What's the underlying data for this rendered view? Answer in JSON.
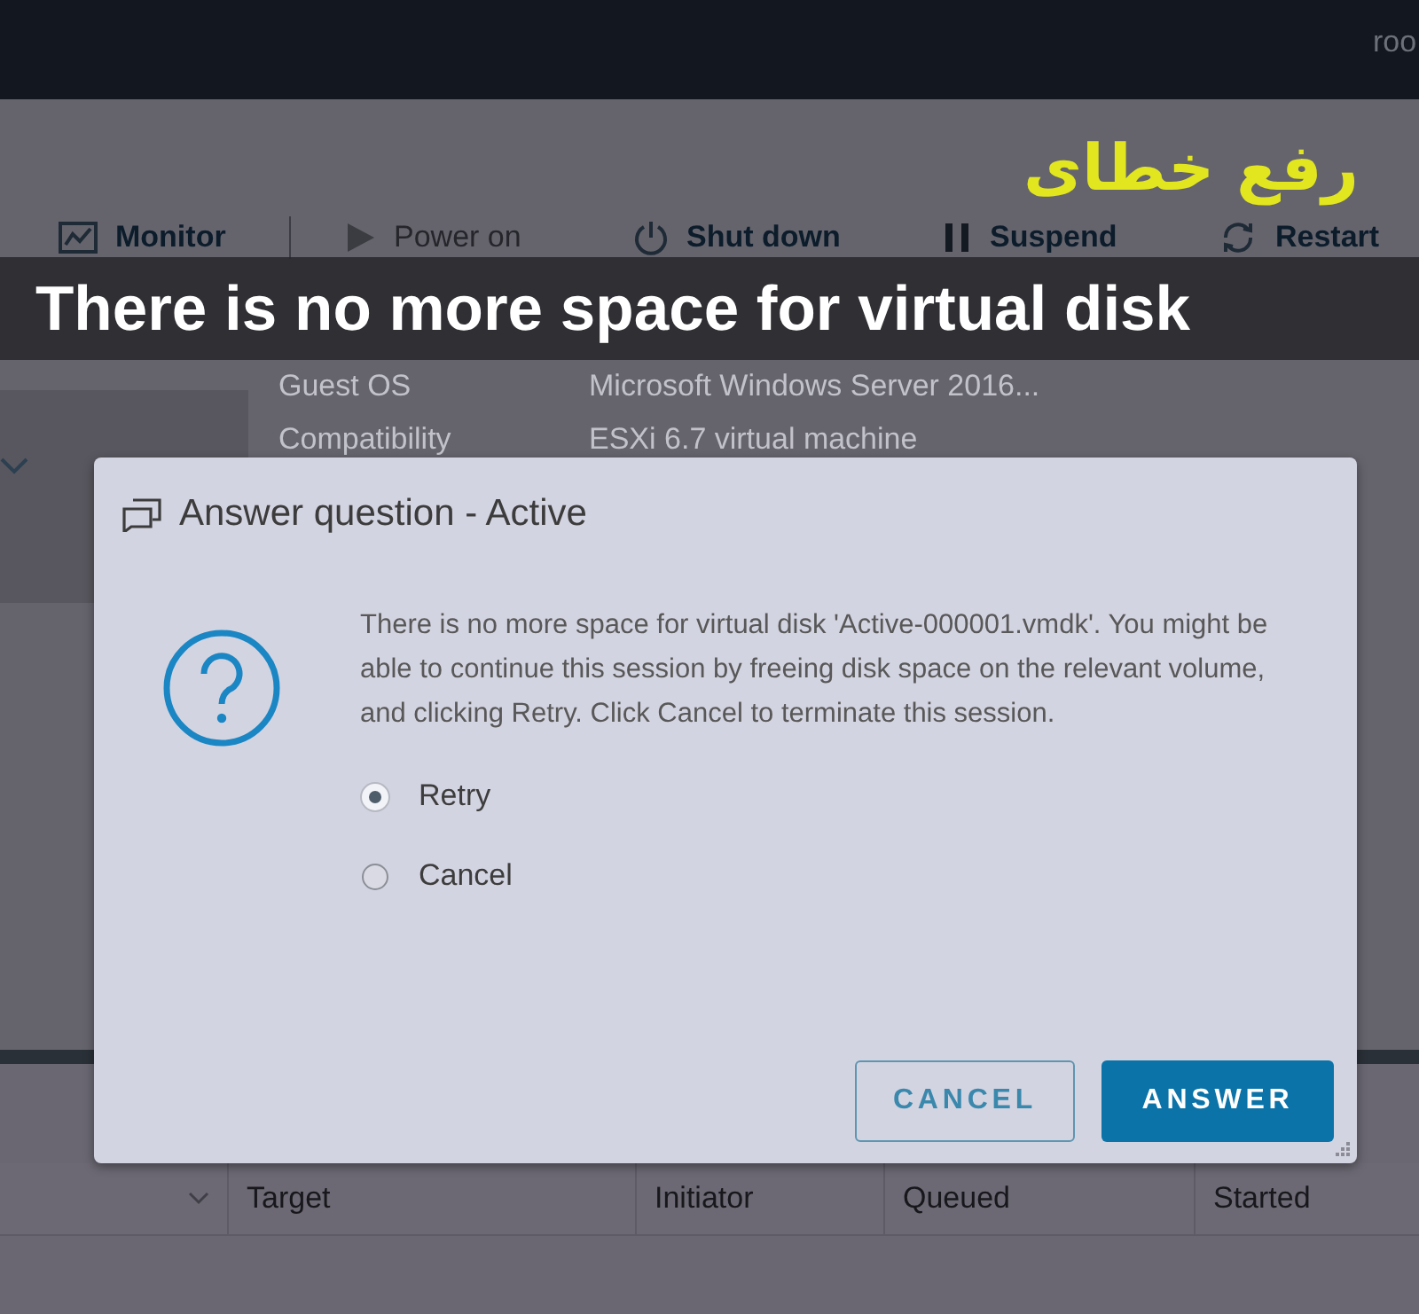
{
  "header": {
    "user": "roo"
  },
  "toolbar": [
    {
      "kind": "monitor",
      "label": "Monitor",
      "disabled": false
    },
    {
      "kind": "power",
      "label": "Power on",
      "disabled": true
    },
    {
      "kind": "shutdown",
      "label": "Shut down",
      "disabled": false
    },
    {
      "kind": "suspend",
      "label": "Suspend",
      "disabled": false
    },
    {
      "kind": "restart",
      "label": "Restart",
      "disabled": false
    }
  ],
  "properties": [
    {
      "label": "Guest OS",
      "value": "Microsoft Windows Server 2016..."
    },
    {
      "label": "Compatibility",
      "value": "ESXi 6.7 virtual machine"
    }
  ],
  "tasks_table": {
    "columns": [
      {
        "label": "Target"
      },
      {
        "label": "Initiator"
      },
      {
        "label": "Queued"
      },
      {
        "label": "Started"
      }
    ]
  },
  "dialog": {
    "title": "Answer question - Active",
    "message": "There is no more space for virtual disk 'Active-000001.vmdk'. You might be able to continue this session by freeing disk space on the relevant volume, and clicking Retry. Click Cancel to terminate this session.",
    "options": [
      {
        "label": "Retry",
        "selected": true
      },
      {
        "label": "Cancel",
        "selected": false
      }
    ],
    "buttons": [
      {
        "kind": "secondary",
        "label": "CANCEL"
      },
      {
        "kind": "primary",
        "label": "ANSWER"
      }
    ]
  },
  "banner": {
    "kicker": "رفع خطای",
    "title": "There is no more space for virtual disk"
  }
}
